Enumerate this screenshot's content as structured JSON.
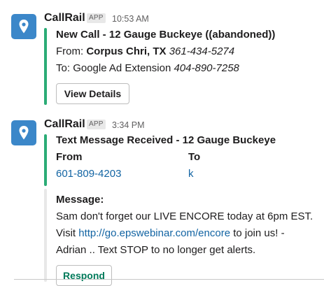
{
  "messages": [
    {
      "sender": "CallRail",
      "badge": "APP",
      "time": "10:53 AM",
      "title": "New Call - 12 Gauge Buckeye ((abandoned))",
      "from_label": "From:",
      "from_location": "Corpus Chri, TX",
      "from_number": "361-434-5274",
      "to_label": "To:",
      "to_name": "Google Ad Extension",
      "to_number": "404-890-7258",
      "button": "View Details"
    },
    {
      "sender": "CallRail",
      "badge": "APP",
      "time": "3:34 PM",
      "title": "Text Message Received - 12 Gauge Buckeye",
      "from_header": "From",
      "to_header": "To",
      "from_value": "601-809-4203",
      "to_value": "k",
      "message_label": "Message:",
      "message_pre": "Sam don't forget our LIVE ENCORE today at 6pm EST.  Visit ",
      "message_link": "http://go.epswebinar.com/encore",
      "message_post": " to join us!  - Adrian .. Text STOP to no longer get alerts.",
      "button": "Respond"
    }
  ],
  "colors": {
    "avatar": "#3b87c9",
    "accent_bar": "#2bac76",
    "link": "#1264a3",
    "respond_text": "#007a5a"
  },
  "icons": {
    "avatar": "location-pin-icon"
  }
}
